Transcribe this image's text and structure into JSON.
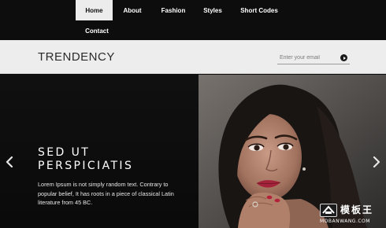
{
  "nav": {
    "items": [
      {
        "label": "Home",
        "active": true
      },
      {
        "label": "About",
        "active": false
      },
      {
        "label": "Fashion",
        "active": false
      },
      {
        "label": "Styles",
        "active": false
      },
      {
        "label": "Short Codes",
        "active": false
      },
      {
        "label": "Contact",
        "active": false
      }
    ]
  },
  "header": {
    "logo": "TRENDENCY",
    "email_placeholder": "Enter your email",
    "submit_icon": "arrow-right-circle-icon"
  },
  "slide": {
    "title": "SED UT PERSPICIATIS",
    "text": "Lorem Ipsum is not simply random text. Contrary to popular belief, It has roots in a piece of classical Latin literature from 45 BC.",
    "prev_icon": "chevron-left-icon",
    "next_icon": "chevron-right-icon"
  },
  "watermark": {
    "cn": "模板王",
    "en": "MOBANWANG.COM"
  },
  "colors": {
    "page_bg": "#0c0c0c",
    "header_bg": "#ededed",
    "active_tab_bg": "#ececec",
    "text_light": "#ffffff"
  }
}
